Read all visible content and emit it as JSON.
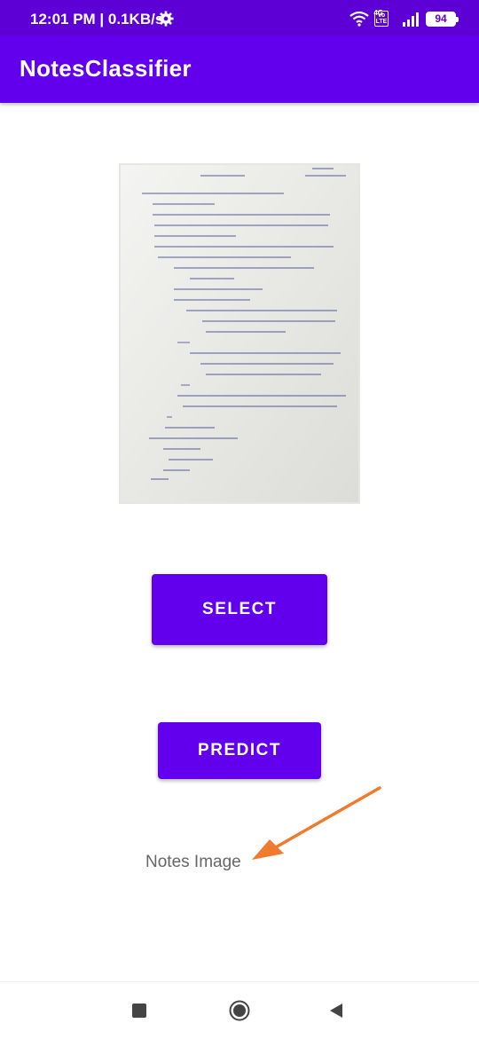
{
  "status_bar": {
    "time": "12:01 PM | 0.1KB/s",
    "battery": "94",
    "volte": "Vo LTE",
    "network": "4G"
  },
  "app_bar": {
    "title": "NotesClassifier"
  },
  "main": {
    "image_alt": "handwritten notes photo",
    "select_label": "SELECT",
    "predict_label": "PREDICT",
    "caption": "Notes Image"
  },
  "colors": {
    "primary": "#6200ee",
    "status": "#5c00d6",
    "arrow": "#f07b2e"
  }
}
